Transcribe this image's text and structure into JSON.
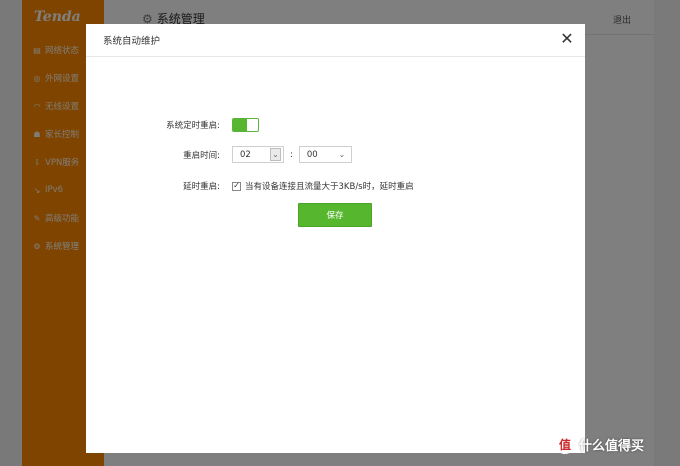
{
  "brand": {
    "logo_text": "Tenda",
    "accent_color": "#ff8a00"
  },
  "sidebar": {
    "items": [
      {
        "label": "网络状态",
        "icon": "network-status-icon",
        "glyph": "▤"
      },
      {
        "label": "外网设置",
        "icon": "globe-icon",
        "glyph": "◎"
      },
      {
        "label": "无线设置",
        "icon": "wifi-icon",
        "glyph": "◠"
      },
      {
        "label": "家长控制",
        "icon": "parental-control-icon",
        "glyph": "☗"
      },
      {
        "label": "VPN服务",
        "icon": "vpn-icon",
        "glyph": "⇩"
      },
      {
        "label": "IPv6",
        "icon": "ipv6-icon",
        "glyph": "↘"
      },
      {
        "label": "高级功能",
        "icon": "tools-icon",
        "glyph": "✎"
      },
      {
        "label": "系统管理",
        "icon": "gear-icon",
        "glyph": "⚙",
        "active": true
      }
    ]
  },
  "header": {
    "title": "系统管理",
    "logout": "退出"
  },
  "dialog": {
    "title": "系统自动维护",
    "close_glyph": "✕",
    "scheduled_reboot": {
      "label": "系统定时重启:",
      "enabled": true
    },
    "reboot_time": {
      "label": "重启时间:",
      "hour": "02",
      "separator": ":",
      "minute": "00"
    },
    "delay_reboot": {
      "label": "延时重启:",
      "checked": true,
      "text": "当有设备连接且流量大于3KB/s时，延时重启"
    },
    "save_label": "保存",
    "button_color": "#56b72f"
  },
  "watermark": {
    "badge": "值",
    "text": "什么值得买"
  }
}
